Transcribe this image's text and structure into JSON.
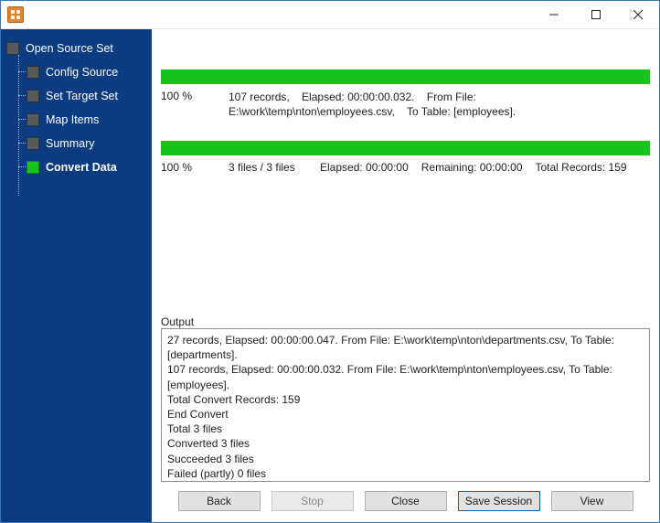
{
  "titlebar": {
    "title": ""
  },
  "sidebar": {
    "items": [
      {
        "label": "Open Source Set",
        "active": false
      },
      {
        "label": "Config Source",
        "active": false
      },
      {
        "label": "Set Target Set",
        "active": false
      },
      {
        "label": "Map Items",
        "active": false
      },
      {
        "label": "Summary",
        "active": false
      },
      {
        "label": "Convert Data",
        "active": true
      }
    ]
  },
  "progress1": {
    "percent": "100 %",
    "records": "107 records,",
    "elapsed": "Elapsed: 00:00:00.032.",
    "from_label": "From File:",
    "from_value": "E:\\work\\temp\\nton\\employees.csv,",
    "to_label": "To Table: [employees]."
  },
  "progress2": {
    "percent": "100 %",
    "files": "3 files / 3 files",
    "elapsed": "Elapsed: 00:00:00",
    "remaining": "Remaining: 00:00:00",
    "total": "Total Records: 159"
  },
  "output": {
    "label": "Output",
    "lines": [
      "27 records,    Elapsed: 00:00:00.047.    From File: E:\\work\\temp\\nton\\departments.csv,    To Table: [departments].",
      "107 records,    Elapsed: 00:00:00.032.    From File: E:\\work\\temp\\nton\\employees.csv,    To Table: [employees].",
      "Total Convert Records: 159",
      "End Convert",
      "Total 3 files",
      "Converted 3 files",
      "Succeeded 3 files",
      "Failed (partly) 0 files"
    ]
  },
  "buttons": {
    "back": "Back",
    "stop": "Stop",
    "close": "Close",
    "save": "Save Session",
    "view": "View"
  }
}
